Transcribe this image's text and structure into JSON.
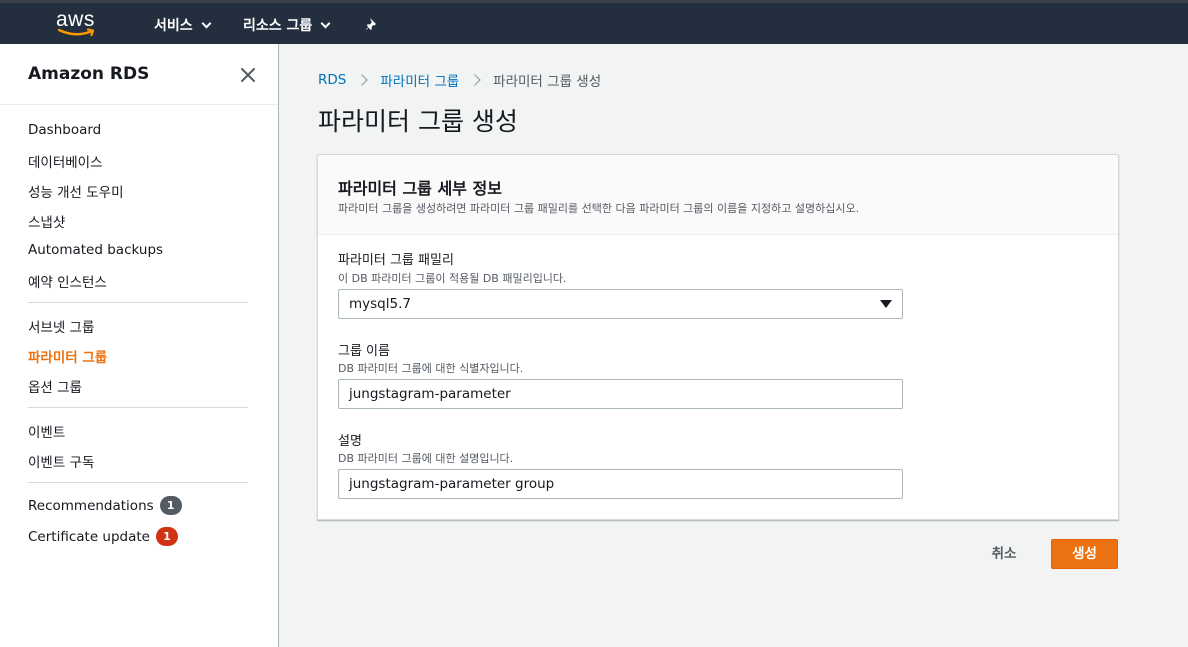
{
  "topnav": {
    "logo_text": "aws",
    "services_label": "서비스",
    "resource_groups_label": "리소스 그룹",
    "pin_icon": "pin-icon"
  },
  "sidebar": {
    "title": "Amazon RDS",
    "close_icon": "close-icon",
    "items": [
      {
        "label": "Dashboard"
      },
      {
        "label": "데이터베이스"
      },
      {
        "label": "성능 개선 도우미"
      },
      {
        "label": "스냅샷"
      },
      {
        "label": "Automated backups"
      },
      {
        "label": "예약 인스턴스"
      },
      {
        "label": "서브넷 그룹"
      },
      {
        "label": "파라미터 그룹"
      },
      {
        "label": "옵션 그룹"
      },
      {
        "label": "이벤트"
      },
      {
        "label": "이벤트 구독"
      },
      {
        "label": "Recommendations",
        "badge": "1"
      },
      {
        "label": "Certificate update",
        "badge": "1"
      }
    ],
    "active_item": "파라미터 그룹"
  },
  "breadcrumb": {
    "items": [
      "RDS",
      "파라미터 그룹",
      "파라미터 그룹 생성"
    ]
  },
  "page_title": "파라미터 그룹 생성",
  "panel": {
    "title": "파라미터 그룹 세부 정보",
    "description": "파라미터 그룹을 생성하려면 파라미터 그룹 패밀리를 선택한 다음 파라미터 그룹의 이름을 지정하고 설명하십시오.",
    "family": {
      "label": "파라미터 그룹 패밀리",
      "description": "이 DB 파라미터 그룹이 적용될 DB 패밀리입니다.",
      "value": "mysql5.7"
    },
    "group_name": {
      "label": "그룹 이름",
      "description": "DB 파라미터 그룹에 대한 식별자입니다.",
      "value": "jungstagram-parameter"
    },
    "group_desc": {
      "label": "설명",
      "description": "DB 파라미터 그룹에 대한 설명입니다.",
      "value": "jungstagram-parameter group"
    }
  },
  "actions": {
    "cancel_label": "취소",
    "create_label": "생성"
  },
  "colors": {
    "nav_bg": "#232f3e",
    "accent": "#ec7211",
    "link": "#0073bb",
    "badge_grey": "#545b64",
    "badge_red": "#d13212"
  }
}
